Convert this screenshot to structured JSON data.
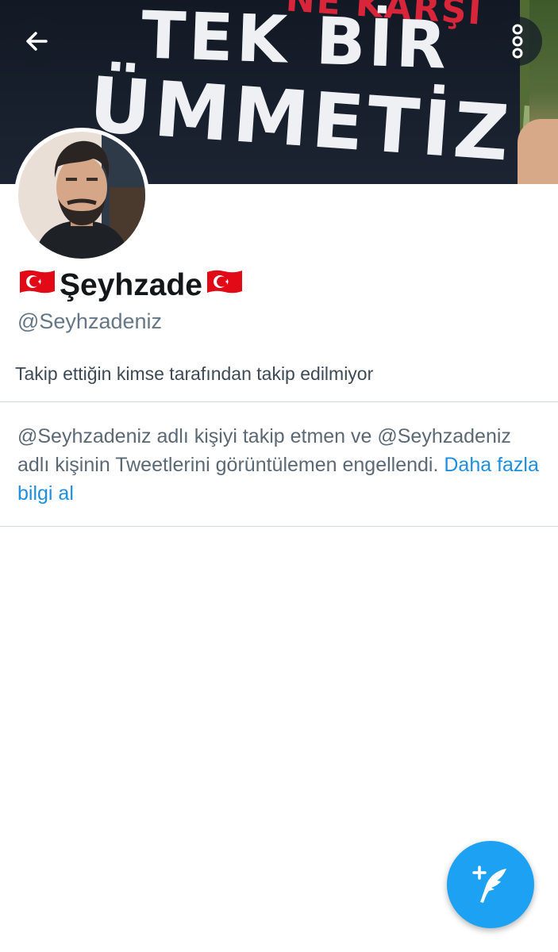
{
  "banner": {
    "sign_top_text": "NE KARŞI",
    "sign_line1": "TEK BİR",
    "sign_line2": "ÜMMETİZ!"
  },
  "toolbar": {
    "back_icon": "arrow-left-icon",
    "more_icon": "vertical-ellipsis-icon"
  },
  "profile": {
    "name_flag_left": "🇹🇷",
    "display_name": "Şeyhzade",
    "name_flag_right": "🇹🇷",
    "handle": "@Seyhzadeniz",
    "followed_by_text": "Takip ettiğin kimse tarafından takip edilmiyor"
  },
  "blocked_notice": {
    "message": "@Seyhzadeniz adlı kişiyi takip etmen ve @Seyhzadeniz adlı kişinin Tweetlerini görüntülemen engellendi.",
    "link_label": "Daha fazla bilgi al"
  },
  "fab": {
    "icon": "compose-tweet-icon"
  },
  "colors": {
    "accent": "#1da1f2",
    "link": "#1d8fe0",
    "secondary_text": "#657786",
    "divider": "#cfd9de"
  }
}
